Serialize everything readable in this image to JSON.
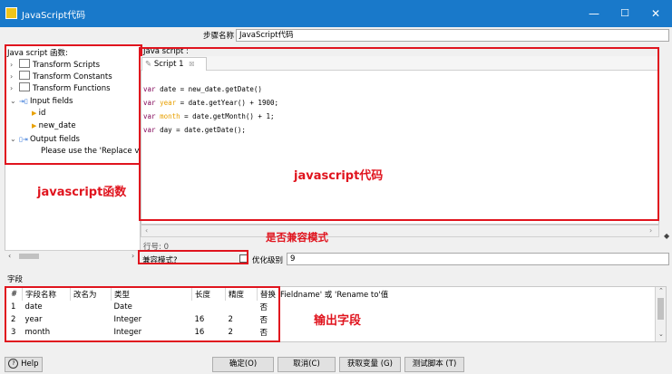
{
  "window": {
    "title": "JavaScript代码",
    "minimize": "—",
    "maximize": "☐",
    "close": "✕"
  },
  "step_name": {
    "label": "步骤名称",
    "value": "JavaScript代码"
  },
  "functions_panel": {
    "title": "Java script 函数:",
    "items": [
      {
        "label": "Transform Scripts"
      },
      {
        "label": "Transform Constants"
      },
      {
        "label": "Transform Functions"
      },
      {
        "label": "Input fields"
      },
      {
        "label": "id"
      },
      {
        "label": "new_date"
      },
      {
        "label": "Output fields"
      },
      {
        "label": "Please use the 'Replace v"
      }
    ]
  },
  "script_panel": {
    "title": "Java script :",
    "tab": "Script 1",
    "tab_close": "☒",
    "lines": [
      {
        "kw": "var",
        "name": "date",
        "rest": " = new_date.getDate()"
      },
      {
        "kw": "var",
        "name": "year",
        "rest": " = date.getYear() + 1900;"
      },
      {
        "kw": "var",
        "name": "month",
        "rest": " = date.getMonth() + 1;"
      },
      {
        "kw": "var",
        "name": "day",
        "rest": " = date.getDate();"
      }
    ],
    "row_info": "行号: 0"
  },
  "compat": {
    "label": "兼容模式?",
    "checked": false
  },
  "optimize": {
    "label": "优化级别",
    "value": "9"
  },
  "fields": {
    "title": "字段",
    "headers": [
      "#",
      "字段名称",
      "改名为",
      "类型",
      "长度",
      "精度",
      "替换 'Fieldname' 或 'Rename to'值"
    ],
    "rows": [
      [
        "1",
        "date",
        "",
        "Date",
        "",
        "",
        "否"
      ],
      [
        "2",
        "year",
        "",
        "Integer",
        "16",
        "2",
        "否"
      ],
      [
        "3",
        "month",
        "",
        "Integer",
        "16",
        "2",
        "否"
      ]
    ]
  },
  "annotations": {
    "functions": "javascript函数",
    "code": "javascript代码",
    "compat": "是否兼容模式",
    "output": "输出字段"
  },
  "buttons": {
    "help": "Help",
    "ok": "确定(O)",
    "cancel": "取消(C)",
    "get_vars": "获取变量 (G)",
    "test": "测试脚本 (T)"
  },
  "colors": {
    "titlebar": "#1979ca",
    "annotation": "#e0141e",
    "keyword": "#7f0055",
    "variable": "#e8a000"
  }
}
